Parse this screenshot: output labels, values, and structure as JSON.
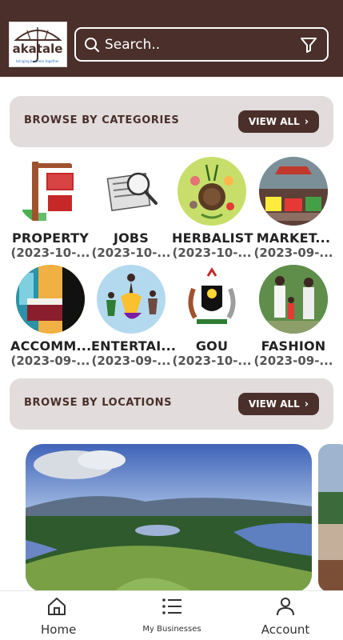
{
  "header": {
    "logo_text": "akatale",
    "logo_tagline": "bringing business together",
    "search_placeholder": "Search.."
  },
  "categories_section": {
    "title": "BROWSE BY CATEGORIES",
    "view_all": "VIEW ALL"
  },
  "categories": [
    {
      "name": "PROPERTY",
      "date": "(2023-10-..."
    },
    {
      "name": "JOBS",
      "date": "(2023-10-..."
    },
    {
      "name": "HERBALIST",
      "date": "(2023-10-..."
    },
    {
      "name": "MARKET...",
      "date": "(2023-09-..."
    },
    {
      "name": "ACCOMM...",
      "date": "(2023-09-..."
    },
    {
      "name": "ENTERTAI...",
      "date": "(2023-09-..."
    },
    {
      "name": "GOU",
      "date": "(2023-10-..."
    },
    {
      "name": "FASHION",
      "date": "(2023-09-..."
    }
  ],
  "locations_section": {
    "title": "BROWSE BY LOCATIONS",
    "view_all": "VIEW ALL"
  },
  "bottom_nav": {
    "home": "Home",
    "businesses": "My Businesses",
    "account": "Account"
  },
  "colors": {
    "brand": "#4a2f2a",
    "section_bg": "#e2dcdc"
  }
}
